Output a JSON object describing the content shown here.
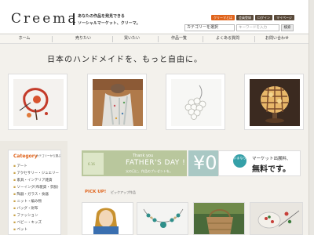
{
  "header": {
    "logo": "Creema",
    "tagline_1": "あなたの作品を発見できる",
    "tagline_2": "ソーシャルマーケット、クリーマ。",
    "top_buttons": [
      "クリーマとは",
      "会員登録",
      "ログイン",
      "マイページ"
    ],
    "category_select": "カテゴリーを選択",
    "search_placeholder": "キーワードを入力",
    "search_button": "検索"
  },
  "nav": {
    "items": [
      "ホーム",
      "売りたい",
      "買いたい",
      "作品一覧",
      "よくある質問",
      "お問い合わせ"
    ]
  },
  "hero": {
    "title": "日本のハンドメイドを、もっと自由に。"
  },
  "products": [
    {
      "icon": "painting-image"
    },
    {
      "icon": "scarf-image"
    },
    {
      "icon": "pearl-brooch-image"
    },
    {
      "icon": "lamp-image"
    }
  ],
  "sidebar": {
    "title": "Category",
    "subtitle": "カテゴリーから選ぶ",
    "items": [
      "アート",
      "アクセサリー・ジュエリー",
      "家具・インテリア雑貨",
      "ソーイング(布雑貨・衣服)",
      "陶器・ガラス・食器",
      "ニット・編み物",
      "バッグ・財布",
      "ファッション",
      "ベビー・キッズ",
      "ペット"
    ]
  },
  "banners": {
    "fathers_day": {
      "line1": "Thank you",
      "line2": "FATHER'S DAY !",
      "line3": "父の日に、作品のプレゼントを。",
      "tile_text": "6.16",
      "color": "#b9c79d"
    },
    "zero": {
      "mark": "¥0",
      "color": "#a9c8c4"
    },
    "market": {
      "badge": "いまなら",
      "line1": "マーケット出展料、",
      "line2": "無料です。"
    }
  },
  "pickup": {
    "title": "PICK UP!",
    "subtitle": "ピックアップ作品"
  },
  "colors": {
    "accent": "#e0641c",
    "brand_dark": "#5a4a3a"
  }
}
